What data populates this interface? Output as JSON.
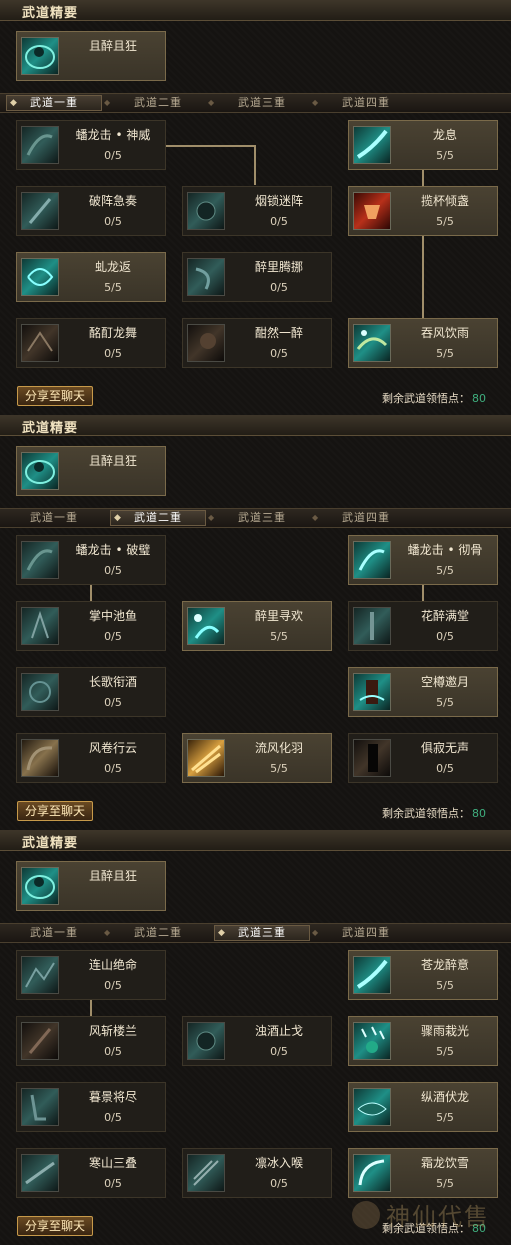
{
  "colors": {
    "accent_points": "#3fae7e",
    "line": "#a08e6a",
    "panel_bg": "#151311"
  },
  "panels": [
    {
      "header": "武道精要",
      "essence": {
        "name": "且醉且狂",
        "icon": "drunk-warrior-icon"
      },
      "tabs": [
        {
          "label": "武道一重",
          "active": true
        },
        {
          "label": "武道二重",
          "active": false
        },
        {
          "label": "武道三重",
          "active": false
        },
        {
          "label": "武道四重",
          "active": false
        }
      ],
      "nodes": [
        {
          "name": "蟠龙击 • 神威",
          "level": "0/5",
          "active": false,
          "icon": "dragon-strike-icon"
        },
        {
          "name": "破阵急奏",
          "level": "0/5",
          "active": false,
          "icon": "blade-icon"
        },
        {
          "name": "烟锁迷阵",
          "level": "0/5",
          "active": false,
          "icon": "smoke-icon"
        },
        {
          "name": "虬龙返",
          "level": "5/5",
          "active": true,
          "icon": "dragon-return-icon"
        },
        {
          "name": "醉里腾挪",
          "level": "0/5",
          "active": false,
          "icon": "dodge-icon"
        },
        {
          "name": "酩酊龙舞",
          "level": "0/5",
          "active": false,
          "icon": "dragon-dance-icon"
        },
        {
          "name": "酣然一醉",
          "level": "0/5",
          "active": false,
          "icon": "drunk-icon"
        },
        {
          "name": "龙息",
          "level": "5/5",
          "active": true,
          "icon": "dragon-breath-icon"
        },
        {
          "name": "揽杯倾盏",
          "level": "5/5",
          "active": true,
          "icon": "cup-icon"
        },
        {
          "name": "吞风饮雨",
          "level": "5/5",
          "active": true,
          "icon": "wind-rain-icon"
        }
      ],
      "share_label": "分享至聊天",
      "remain_label": "剩余武道领悟点：",
      "remain_value": "80"
    },
    {
      "header": "武道精要",
      "essence": {
        "name": "且醉且狂",
        "icon": "drunk-warrior-icon"
      },
      "tabs": [
        {
          "label": "武道一重",
          "active": false
        },
        {
          "label": "武道二重",
          "active": true
        },
        {
          "label": "武道三重",
          "active": false
        },
        {
          "label": "武道四重",
          "active": false
        }
      ],
      "nodes": [
        {
          "name": "蟠龙击 • 破璧",
          "level": "0/5",
          "active": false,
          "icon": "dragon-strike-icon"
        },
        {
          "name": "掌中池鱼",
          "level": "0/5",
          "active": false,
          "icon": "palm-icon"
        },
        {
          "name": "醉里寻欢",
          "level": "5/5",
          "active": true,
          "icon": "revelry-icon"
        },
        {
          "name": "长歌衔酒",
          "level": "0/5",
          "active": false,
          "icon": "song-wine-icon"
        },
        {
          "name": "风卷行云",
          "level": "0/5",
          "active": false,
          "icon": "whirlwind-icon"
        },
        {
          "name": "流风化羽",
          "level": "5/5",
          "active": true,
          "icon": "feather-wind-icon"
        },
        {
          "name": "蟠龙击 • 彻骨",
          "level": "5/5",
          "active": true,
          "icon": "dragon-strike-icon"
        },
        {
          "name": "花醉满堂",
          "level": "0/5",
          "active": false,
          "icon": "flower-icon"
        },
        {
          "name": "空樽邀月",
          "level": "5/5",
          "active": true,
          "icon": "moon-cup-icon"
        },
        {
          "name": "俱寂无声",
          "level": "0/5",
          "active": false,
          "icon": "silence-icon"
        }
      ],
      "share_label": "分享至聊天",
      "remain_label": "剩余武道领悟点：",
      "remain_value": "80"
    },
    {
      "header": "武道精要",
      "essence": {
        "name": "且醉且狂",
        "icon": "drunk-warrior-icon"
      },
      "tabs": [
        {
          "label": "武道一重",
          "active": false
        },
        {
          "label": "武道二重",
          "active": false
        },
        {
          "label": "武道三重",
          "active": true
        },
        {
          "label": "武道四重",
          "active": false
        }
      ],
      "nodes": [
        {
          "name": "连山绝命",
          "level": "0/5",
          "active": false,
          "icon": "mountain-strike-icon"
        },
        {
          "name": "风斩楼兰",
          "level": "0/5",
          "active": false,
          "icon": "wind-slash-icon"
        },
        {
          "name": "浊酒止戈",
          "level": "0/5",
          "active": false,
          "icon": "wine-halt-icon"
        },
        {
          "name": "暮景将尽",
          "level": "0/5",
          "active": false,
          "icon": "dusk-icon"
        },
        {
          "name": "寒山三叠",
          "level": "0/5",
          "active": false,
          "icon": "cold-mountain-icon"
        },
        {
          "name": "凛冰入喉",
          "level": "0/5",
          "active": false,
          "icon": "ice-icon"
        },
        {
          "name": "苍龙醉意",
          "level": "5/5",
          "active": true,
          "icon": "azure-dragon-icon"
        },
        {
          "name": "骤雨栽光",
          "level": "5/5",
          "active": true,
          "icon": "storm-icon"
        },
        {
          "name": "纵酒伏龙",
          "level": "5/5",
          "active": true,
          "icon": "subdue-dragon-icon"
        },
        {
          "name": "霜龙饮雪",
          "level": "5/5",
          "active": true,
          "icon": "frost-dragon-icon"
        }
      ],
      "share_label": "分享至聊天",
      "remain_label": "剩余武道领悟点：",
      "remain_value": "80"
    }
  ],
  "watermark": {
    "text": "神仙代售",
    "icon": "mascot-seal-icon"
  }
}
